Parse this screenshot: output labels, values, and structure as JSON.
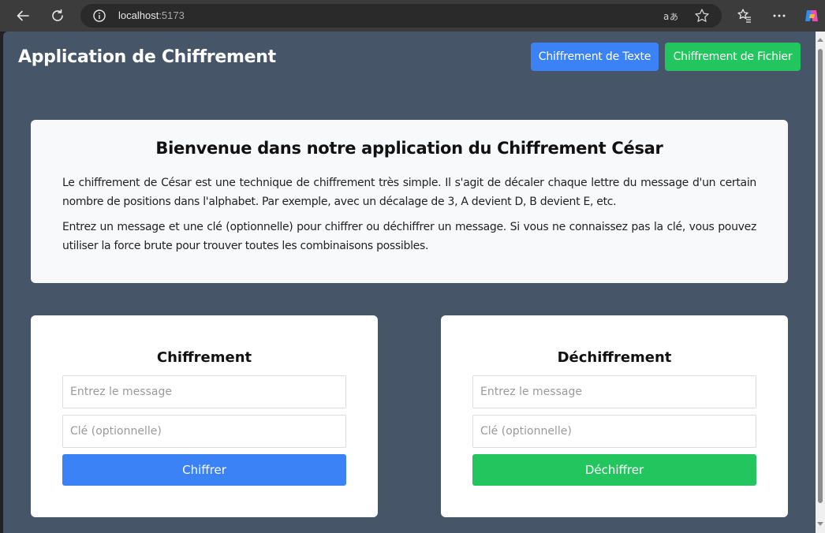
{
  "browser": {
    "url_host": "localhost",
    "url_port": ":5173"
  },
  "header": {
    "title": "Application de Chiffrement",
    "tab_text_label": "Chiffrement de Texte",
    "tab_file_label": "Chiffrement de Fichier"
  },
  "intro": {
    "heading": "Bienvenue dans notre application du Chiffrement César",
    "paragraph_1": "Le chiffrement de César est une technique de chiffrement très simple. Il s'agit de décaler chaque lettre du message d'un certain nombre de positions dans l'alphabet. Par exemple, avec un décalage de 3, A devient D, B devient E, etc.",
    "paragraph_2": "Entrez un message et une clé (optionnelle) pour chiffrer ou déchiffrer un message. Si vous ne connaissez pas la clé, vous pouvez utiliser la force brute pour trouver toutes les combinaisons possibles."
  },
  "encrypt": {
    "title": "Chiffrement",
    "message_placeholder": "Entrez le message",
    "key_placeholder": "Clé (optionnelle)",
    "button_label": "Chiffrer"
  },
  "decrypt": {
    "title": "Déchiffrement",
    "message_placeholder": "Entrez le message",
    "key_placeholder": "Clé (optionnelle)",
    "button_label": "Déchiffrer"
  },
  "colors": {
    "page_background": "#465568",
    "blue_accent": "#3b82f6",
    "green_accent": "#22c55e"
  },
  "icons": [
    "back-arrow-icon",
    "refresh-icon",
    "info-icon",
    "read-aloud-icon",
    "favorite-star-icon",
    "favorites-list-icon",
    "more-options-icon",
    "copilot-icon"
  ]
}
